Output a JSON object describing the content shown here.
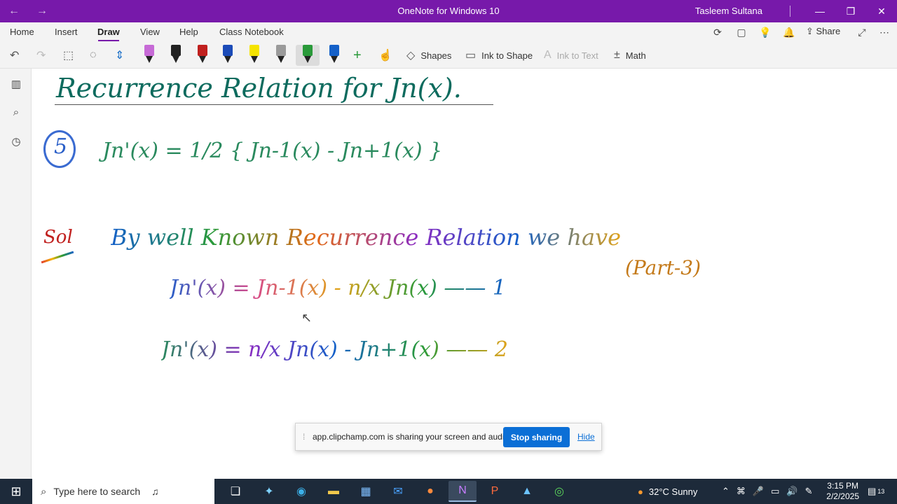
{
  "window": {
    "title": "OneNote for Windows 10",
    "user": "Tasleem Sultana"
  },
  "menu": {
    "tabs": [
      "Home",
      "Insert",
      "Draw",
      "View",
      "Help",
      "Class Notebook"
    ],
    "active_tab": "Draw",
    "share_label": "Share"
  },
  "ribbon": {
    "shapes_label": "Shapes",
    "ink_to_shape_label": "Ink to Shape",
    "ink_to_text_label": "Ink to Text",
    "math_label": "Math",
    "pens": [
      {
        "color": "#c66ad6"
      },
      {
        "color": "#222222"
      },
      {
        "color": "#c0201e"
      },
      {
        "color": "#1b4bb8"
      },
      {
        "color": "#f5e400"
      },
      {
        "color": "#9a9a9a"
      },
      {
        "color": "#2a9a3a"
      },
      {
        "color": "#1460c8"
      }
    ]
  },
  "note": {
    "heading": "Recurrence Relation for Jn(x).",
    "problem_number": "5",
    "equation": "Jn'(x) = 1/2 { Jn-1(x) - Jn+1(x) }",
    "sol_label": "Sol",
    "intro": "By well Known Recurrence Relation we have",
    "eq1": "Jn'(x) = Jn-1(x) - n/x Jn(x) —— 1",
    "eq1_note": "(Part-3)",
    "eq2": "Jn'(x) = n/x Jn(x) - Jn+1(x) —— 2"
  },
  "sharing_bar": {
    "message": "app.clipchamp.com is sharing your screen and audio.",
    "stop_label": "Stop sharing",
    "hide_label": "Hide"
  },
  "taskbar": {
    "search_placeholder": "Type here to search",
    "weather": "32°C  Sunny",
    "time": "3:15 PM",
    "date": "2/2/2025",
    "notification_count": "13"
  }
}
